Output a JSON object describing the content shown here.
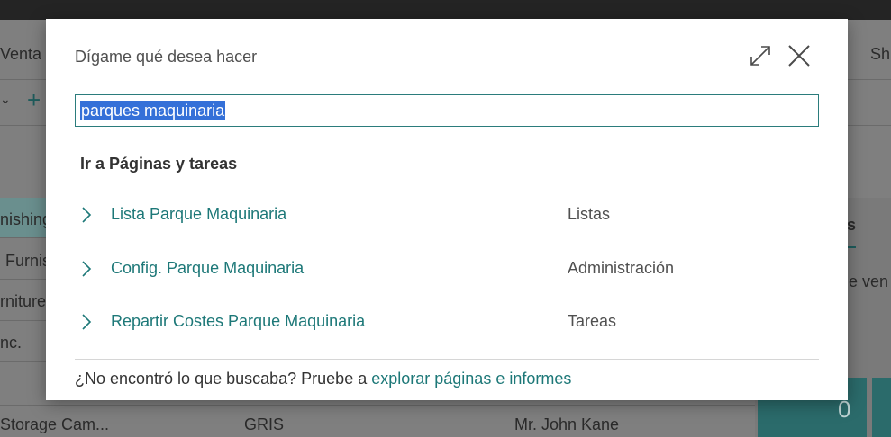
{
  "background": {
    "tab_left": "Venta",
    "tab_right": "Sh",
    "rows_left": [
      "nishing",
      "Furnis",
      "rniture",
      "nc."
    ],
    "bottom_row": {
      "name": "Storage Cam...",
      "color": "GRIS",
      "contact": "Mr. John Kane"
    },
    "right_heading": "s",
    "right_text": "e ven",
    "tile_value": "0"
  },
  "dialog": {
    "title": "Dígame qué desea hacer",
    "search": {
      "value": "parques maquinaria"
    },
    "section_heading": "Ir a Páginas y tareas",
    "results": [
      {
        "label": "Lista Parque Maquinaria",
        "category": "Listas"
      },
      {
        "label": "Config. Parque Maquinaria",
        "category": "Administración"
      },
      {
        "label": "Repartir Costes Parque Maquinaria",
        "category": "Tareas"
      }
    ],
    "footer": {
      "text": "¿No encontró lo que buscaba? Pruebe a ",
      "link": "explorar páginas e informes"
    }
  },
  "colors": {
    "accent": "#1d7878",
    "selection": "#3470d8",
    "overlay": "#7f7f7f"
  },
  "icons": [
    "expand-icon",
    "close-icon",
    "chevron-right-icon",
    "plus-icon"
  ]
}
